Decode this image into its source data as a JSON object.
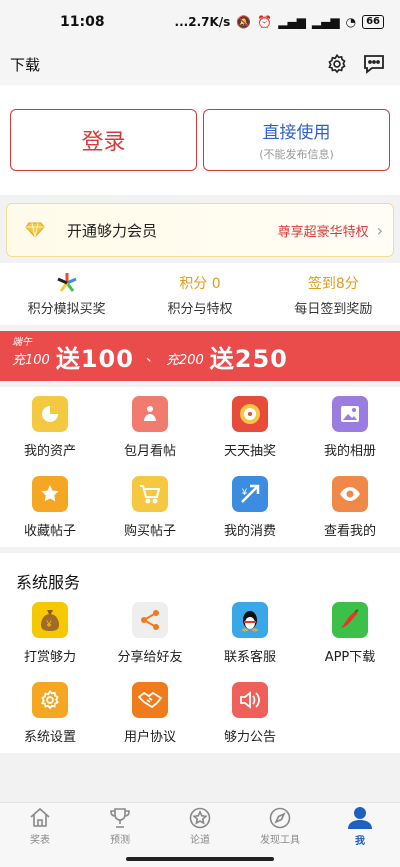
{
  "status": {
    "time": "11:08",
    "speed": "2.7K/s",
    "battery": "66"
  },
  "header": {
    "title": "下载",
    "icons": [
      "gear-icon",
      "chat-icon"
    ]
  },
  "login": {
    "login_label": "登录",
    "direct_label": "直接使用",
    "direct_sub": "(不能发布信息)"
  },
  "vip": {
    "label": "开通够力会员",
    "benefit": "尊享超豪华特权"
  },
  "stats": [
    {
      "top": "",
      "label": "积分模拟买奖",
      "icon": "pinwheel-icon"
    },
    {
      "top": "积分 0",
      "label": "积分与特权"
    },
    {
      "top": "签到8分",
      "label": "每日签到奖励"
    }
  ],
  "banner": {
    "tag": "端午",
    "small1": "充100",
    "big1": "送100",
    "sep": "、",
    "small2": "充200",
    "big2": "送250"
  },
  "grid1": [
    {
      "label": "我的资产",
      "icon": "pie-chart-icon",
      "color": "#f5c842"
    },
    {
      "label": "包月看帖",
      "icon": "meditation-icon",
      "color": "#f07b6e"
    },
    {
      "label": "天天抽奖",
      "icon": "lottery-wheel-icon",
      "color": "#e84b3a"
    },
    {
      "label": "我的相册",
      "icon": "photo-album-icon",
      "color": "#9b7ce0"
    },
    {
      "label": "收藏帖子",
      "icon": "star-icon",
      "color": "#f5a623"
    },
    {
      "label": "购买帖子",
      "icon": "shopping-cart-icon",
      "color": "#f5c842"
    },
    {
      "label": "我的消费",
      "icon": "yen-arrow-icon",
      "color": "#3a8de0"
    },
    {
      "label": "查看我的",
      "icon": "eye-icon",
      "color": "#f0884a"
    }
  ],
  "services": {
    "title": "系统服务",
    "items": [
      {
        "label": "打赏够力",
        "icon": "money-bag-icon",
        "color": "#f5c800"
      },
      {
        "label": "分享给好友",
        "icon": "share-icon",
        "color": "#eeeeee"
      },
      {
        "label": "联系客服",
        "icon": "qq-penguin-icon",
        "color": "#3aa8e8"
      },
      {
        "label": "APP下载",
        "icon": "chili-pepper-icon",
        "color": "#3cc04a"
      },
      {
        "label": "系统设置",
        "icon": "settings-icon",
        "color": "#f5a623"
      },
      {
        "label": "用户协议",
        "icon": "handshake-icon",
        "color": "#f07b1a"
      },
      {
        "label": "够力公告",
        "icon": "speaker-icon",
        "color": "#f0605a"
      }
    ]
  },
  "tabs": [
    {
      "label": "奖表",
      "icon": "home-icon",
      "active": false
    },
    {
      "label": "预测",
      "icon": "trophy-icon",
      "active": false
    },
    {
      "label": "论道",
      "icon": "star-circle-icon",
      "active": false
    },
    {
      "label": "发现工具",
      "icon": "compass-icon",
      "active": false
    },
    {
      "label": "我",
      "icon": "user-icon",
      "active": true
    }
  ]
}
